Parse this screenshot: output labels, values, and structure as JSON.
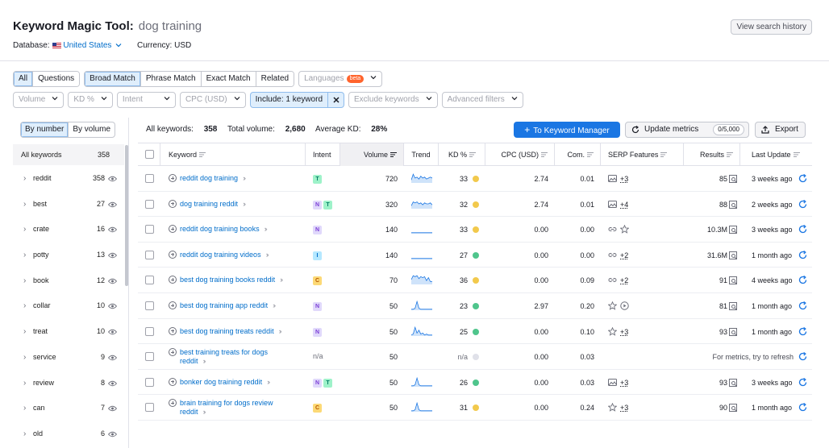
{
  "header": {
    "title": "Keyword Magic Tool:",
    "query": "dog training",
    "database_label": "Database:",
    "database_value": "United States",
    "currency": "Currency: USD",
    "history_button": "View search history"
  },
  "filters": {
    "tabs1": [
      "All",
      "Questions"
    ],
    "tabs2": [
      "Broad Match",
      "Phrase Match",
      "Exact Match",
      "Related"
    ],
    "languages": "Languages",
    "beta": "beta",
    "row2": [
      "Volume",
      "KD %",
      "Intent",
      "CPC (USD)"
    ],
    "include": "Include: 1 keyword",
    "exclude": "Exclude keywords",
    "advanced": "Advanced filters"
  },
  "sidebar": {
    "tab_number": "By number",
    "tab_volume": "By volume",
    "all_label": "All keywords",
    "all_count": "358",
    "groups": [
      {
        "label": "reddit",
        "count": "358"
      },
      {
        "label": "best",
        "count": "27"
      },
      {
        "label": "crate",
        "count": "16"
      },
      {
        "label": "potty",
        "count": "13"
      },
      {
        "label": "book",
        "count": "12"
      },
      {
        "label": "collar",
        "count": "10"
      },
      {
        "label": "treat",
        "count": "10"
      },
      {
        "label": "service",
        "count": "9"
      },
      {
        "label": "review",
        "count": "8"
      },
      {
        "label": "can",
        "count": "7"
      },
      {
        "label": "old",
        "count": "6"
      }
    ]
  },
  "summary": {
    "all_keywords_label": "All keywords:",
    "all_keywords_value": "358",
    "total_volume_label": "Total volume:",
    "total_volume_value": "2,680",
    "avg_kd_label": "Average KD:",
    "avg_kd_value": "28%"
  },
  "actions": {
    "keyword_manager": "To Keyword Manager",
    "update_metrics": "Update metrics",
    "update_badge": "0/5,000",
    "export": "Export"
  },
  "columns": {
    "keyword": "Keyword",
    "intent": "Intent",
    "volume": "Volume",
    "trend": "Trend",
    "kd": "KD %",
    "cpc": "CPC (USD)",
    "com": "Com.",
    "serp": "SERP Features",
    "results": "Results",
    "updated": "Last Update"
  },
  "colors": {
    "kd_yellow": "#f2c94c",
    "kd_green": "#4fc58c",
    "kd_gray": "#e0e1e9",
    "accent": "#1a76e3"
  },
  "rows": [
    {
      "keyword": "reddit dog training",
      "keyword2": "",
      "intent": [
        "T"
      ],
      "volume": "720",
      "kd": "33",
      "kd_color": "#f2c94c",
      "cpc": "2.74",
      "com": "0.01",
      "serp_icons": [
        "image-icon"
      ],
      "serp_more": "+3",
      "results": "85",
      "updated": "3 weeks ago",
      "trend": [
        0.3,
        0.9,
        0.5,
        0.6,
        0.4,
        0.7,
        0.5,
        0.6,
        0.4,
        0.5,
        0.6,
        0.5
      ]
    },
    {
      "keyword": "dog training reddit",
      "keyword2": "",
      "intent": [
        "N",
        "T"
      ],
      "volume": "320",
      "kd": "32",
      "kd_color": "#f2c94c",
      "cpc": "2.74",
      "com": "0.01",
      "serp_icons": [
        "image-icon"
      ],
      "serp_more": "+4",
      "results": "88",
      "updated": "2 weeks ago",
      "trend": [
        0.3,
        0.7,
        0.6,
        0.7,
        0.5,
        0.6,
        0.4,
        0.6,
        0.5,
        0.5,
        0.6,
        0.4
      ]
    },
    {
      "keyword": "reddit dog training books",
      "keyword2": "",
      "intent": [
        "N"
      ],
      "volume": "140",
      "kd": "33",
      "kd_color": "#f2c94c",
      "cpc": "0.00",
      "com": "0.00",
      "serp_icons": [
        "link-icon",
        "star-icon"
      ],
      "serp_more": "",
      "results": "10.3M",
      "updated": "3 weeks ago",
      "trend": [
        0.1,
        0.1,
        0.1,
        0.1,
        0.1,
        0.1,
        0.1,
        0.1,
        0.1,
        0.1,
        0.1,
        0.1
      ]
    },
    {
      "keyword": "reddit dog training videos",
      "keyword2": "",
      "intent": [
        "I"
      ],
      "volume": "140",
      "kd": "27",
      "kd_color": "#4fc58c",
      "cpc": "0.00",
      "com": "0.00",
      "serp_icons": [
        "link-icon"
      ],
      "serp_more": "+2",
      "results": "31.6M",
      "updated": "1 month ago",
      "trend": [
        0.1,
        0.1,
        0.1,
        0.1,
        0.1,
        0.1,
        0.1,
        0.1,
        0.1,
        0.1,
        0.1,
        0.1
      ]
    },
    {
      "keyword": "best dog training books reddit",
      "keyword2": "",
      "intent": [
        "C"
      ],
      "volume": "70",
      "kd": "36",
      "kd_color": "#f2c94c",
      "cpc": "0.00",
      "com": "0.09",
      "serp_icons": [
        "link-icon"
      ],
      "serp_more": "+2",
      "results": "91",
      "updated": "4 weeks ago",
      "trend": [
        0.5,
        0.9,
        0.8,
        0.9,
        0.6,
        0.8,
        0.7,
        0.8,
        0.4,
        0.7,
        0.3,
        0.3
      ]
    },
    {
      "keyword": "best dog training app reddit",
      "keyword2": "",
      "intent": [
        "N"
      ],
      "volume": "50",
      "kd": "23",
      "kd_color": "#4fc58c",
      "cpc": "2.97",
      "com": "0.20",
      "serp_icons": [
        "star-icon",
        "video-icon"
      ],
      "serp_more": "",
      "results": "81",
      "updated": "1 month ago",
      "trend": [
        0.1,
        0.1,
        0.2,
        0.9,
        0.2,
        0.1,
        0.1,
        0.1,
        0.1,
        0.1,
        0.1,
        0.1
      ]
    },
    {
      "keyword": "best dog training treats reddit",
      "keyword2": "",
      "intent": [
        "N"
      ],
      "volume": "50",
      "kd": "25",
      "kd_color": "#4fc58c",
      "cpc": "0.00",
      "com": "0.10",
      "serp_icons": [
        "star-icon"
      ],
      "serp_more": "+3",
      "results": "93",
      "updated": "1 month ago",
      "trend": [
        0.1,
        0.2,
        0.9,
        0.3,
        0.6,
        0.2,
        0.3,
        0.1,
        0.2,
        0.1,
        0.1,
        0.1
      ]
    },
    {
      "keyword": "best training treats for dogs",
      "keyword2": "reddit",
      "intent": [],
      "intent_text": "n/a",
      "volume": "50",
      "kd": "n/a",
      "kd_color": "#e0e1e9",
      "cpc": "0.00",
      "com": "0.03",
      "serp_icons": [],
      "serp_more": "",
      "results": "For metrics, try to refresh",
      "updated": "",
      "trend": []
    },
    {
      "keyword": "bonker dog training reddit",
      "keyword2": "",
      "intent": [
        "N",
        "T"
      ],
      "volume": "50",
      "kd": "26",
      "kd_color": "#4fc58c",
      "cpc": "0.00",
      "com": "0.03",
      "serp_icons": [
        "image-icon"
      ],
      "serp_more": "+3",
      "results": "93",
      "updated": "3 weeks ago",
      "trend": [
        0.1,
        0.1,
        0.2,
        0.9,
        0.2,
        0.1,
        0.1,
        0.1,
        0.1,
        0.1,
        0.1,
        0.1
      ]
    },
    {
      "keyword": "brain training for dogs review",
      "keyword2": "reddit",
      "intent": [
        "C"
      ],
      "volume": "50",
      "kd": "31",
      "kd_color": "#f2c94c",
      "cpc": "0.00",
      "com": "0.24",
      "serp_icons": [
        "star-icon"
      ],
      "serp_more": "+3",
      "results": "90",
      "updated": "1 month ago",
      "trend": [
        0.1,
        0.1,
        0.2,
        0.9,
        0.2,
        0.1,
        0.1,
        0.1,
        0.1,
        0.1,
        0.1,
        0.1
      ]
    }
  ]
}
